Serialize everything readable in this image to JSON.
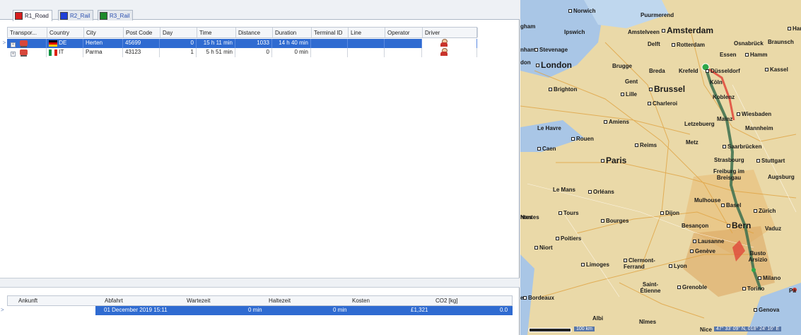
{
  "tabs": [
    {
      "label": "R1_Road",
      "color": "#d71e1e"
    },
    {
      "label": "R2_Rail",
      "color": "#1e3fd7"
    },
    {
      "label": "R3_Rail",
      "color": "#1e8a2c"
    }
  ],
  "grid": {
    "columns": [
      "Transpor...",
      "Country",
      "City",
      "Post Code",
      "Day",
      "Time",
      "Distance",
      "Duration",
      "Terminal ID",
      "Line",
      "Operator",
      "Driver"
    ],
    "rows": [
      {
        "country": "DE",
        "city": "Herten",
        "postcode": "45699",
        "day": "0",
        "time": "15 h 11 min",
        "distance": "1033",
        "duration": "14 h 40 min"
      },
      {
        "country": "IT",
        "city": "Parma",
        "postcode": "43123",
        "day": "1",
        "time": "5 h 51 min",
        "distance": "0",
        "duration": "0 min"
      }
    ]
  },
  "bottom_grid": {
    "columns": [
      "Ankunft",
      "Abfahrt",
      "Wartezeit",
      "Haltezeit",
      "Kosten",
      "CO2 [kg]"
    ],
    "row": {
      "abfahrt": "01 December 2019 15:11",
      "wartezeit": "0 min",
      "haltezeit": "0 min",
      "kosten": "£1,321",
      "co2": "0.0"
    }
  },
  "map": {
    "cities": [
      "Norwich",
      "Amsterdam",
      "Ipswich",
      "Amstelveen",
      "Delft",
      "Rotterdam",
      "Osnabrück",
      "Braunsch",
      "Stevenage",
      "Essen",
      "Hamm",
      "London",
      "Brugge",
      "Breda",
      "Krefeld",
      "Düsseldorf",
      "Kassel",
      "Gent",
      "Köln",
      "Brighton",
      "Brussel",
      "Lille",
      "Koblenz",
      "Charleroi",
      "Amiens",
      "Wiesbaden",
      "Mainz",
      "Le Havre",
      "Letzebuerg",
      "Mannheim",
      "Rouen",
      "Reims",
      "Metz",
      "Saarbrücken",
      "Caen",
      "Paris",
      "Strasbourg",
      "Stuttgart",
      "Freiburg im Breisgau",
      "Augsburg",
      "Le Mans",
      "Orléans",
      "Mulhouse",
      "Basel",
      "Tours",
      "Dijon",
      "Zürich",
      "Nantes",
      "Bourges",
      "Besançon",
      "Bern",
      "Vaduz",
      "Poitiers",
      "Lausanne",
      "Niort",
      "Genève",
      "Busto Arsizio",
      "Limoges",
      "Clermont-Ferrand",
      "Lyon",
      "Milano",
      "Saint-Étienne",
      "Grenoble",
      "Torino",
      "Bordeaux",
      "Genova",
      "Albi",
      "Nîmes",
      "Pa",
      "Harr",
      "gham",
      "nham",
      "don",
      "ntes",
      "e",
      "Puurmerend",
      "Nice"
    ],
    "scale": "100 km",
    "coordinates": "47° 33' 09\" N, 018° 24' 16\" E"
  }
}
